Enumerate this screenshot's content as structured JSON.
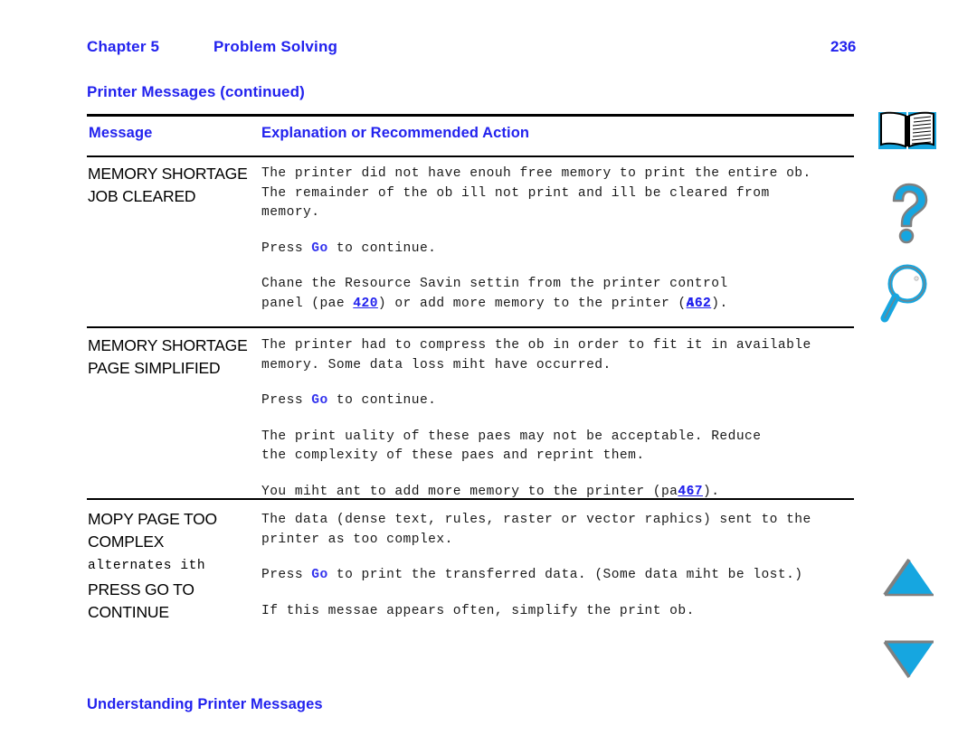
{
  "header": {
    "chapter": "Chapter 5",
    "title": "Problem Solving",
    "page_number": "236"
  },
  "table_title": "Printer Messages (continued)",
  "columns": {
    "message": "Message",
    "explanation": "Explanation or Recommended Action"
  },
  "footer": {
    "label": "Understanding Printer Messages"
  },
  "colors": {
    "link_blue": "#2222ee",
    "icon_cyan": "#16a6e0",
    "text_black": "#000000"
  },
  "rows": [
    {
      "message_lines": [
        "MEMORY SHORTAGE",
        "JOB CLEARED"
      ],
      "message_alt": null,
      "paragraphs": [
        {
          "lines": [
            "The printer did not have enouh free memory to print the entire ob.",
            "The remainder of the ob ill not print and ill be cleared from",
            "memory."
          ]
        },
        {
          "lines": [
            "Press {Go} to continue."
          ],
          "keyword": "Go"
        },
        {
          "lines": [
            "Chane the Resource Savin settin from the printer control",
            "panel (pae {420}) or add more memory to the printer ({A62})."
          ],
          "links": [
            "420",
            "A62"
          ],
          "link_overlap": "462"
        }
      ]
    },
    {
      "message_lines": [
        "MEMORY SHORTAGE",
        "PAGE SIMPLIFIED"
      ],
      "message_alt": null,
      "paragraphs": [
        {
          "lines": [
            "The printer had to compress the ob in order to fit it in available",
            "memory. Some data loss miht have occurred."
          ]
        },
        {
          "lines": [
            "Press {Go} to continue."
          ],
          "keyword": "Go"
        },
        {
          "lines": [
            "The print uality of these paes may not be acceptable. Reduce",
            "the complexity of these paes and reprint them."
          ]
        },
        {
          "lines": [
            "You miht ant to add more memory to the printer (pa{467})."
          ],
          "links": [
            "467"
          ],
          "link_overlap": "46"
        }
      ]
    },
    {
      "message_lines": [
        "MOPY PAGE TOO",
        "COMPLEX"
      ],
      "message_alt": "alternates ith",
      "message_lines2": [
        "PRESS GO TO",
        "CONTINUE"
      ],
      "paragraphs": [
        {
          "lines": [
            "The data (dense text, rules, raster or vector raphics) sent to the",
            "printer as too complex."
          ]
        },
        {
          "lines": [
            "Press {Go} to print the transferred data. (Some data miht be lost.)"
          ],
          "keyword": "Go"
        },
        {
          "lines": [
            "If this messae appears often, simplify the print ob."
          ]
        }
      ]
    }
  ],
  "nav_icons": [
    {
      "name": "book-icon",
      "label": "Contents"
    },
    {
      "name": "question-icon",
      "label": "Help"
    },
    {
      "name": "search-icon",
      "label": "Search"
    },
    {
      "name": "triangle-up-icon",
      "label": "Previous page"
    },
    {
      "name": "triangle-down-icon",
      "label": "Next page"
    }
  ]
}
